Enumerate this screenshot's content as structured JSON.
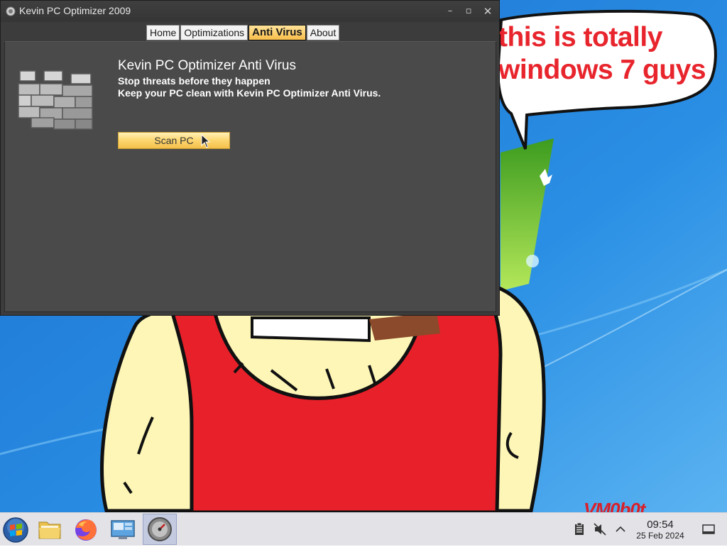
{
  "window": {
    "title": "Kevin PC Optimizer 2009",
    "controls": {
      "minimize": "–",
      "maximize": "▫",
      "close": "✕"
    }
  },
  "tabs": [
    {
      "label": "Home",
      "active": false
    },
    {
      "label": "Optimizations",
      "active": false
    },
    {
      "label": "Anti Virus",
      "active": true
    },
    {
      "label": "About",
      "active": false
    }
  ],
  "antivirus": {
    "heading": "Kevin PC Optimizer Anti Virus",
    "subtitle_1": "Stop threats before they happen",
    "subtitle_2": "Keep your PC clean with Kevin PC Optimizer Anti Virus.",
    "scan_button": "Scan PC",
    "icon": "firewall-brick-wall-icon"
  },
  "desktop": {
    "speech_bubble": [
      "this is totally",
      "windows 7 guys"
    ],
    "watermark": "VM0b0t"
  },
  "taskbar": {
    "items": [
      "start-orb-icon",
      "file-manager-icon",
      "firefox-icon",
      "computer-explorer-icon",
      "optimizer-app-icon"
    ],
    "tray": [
      "clipboard-icon",
      "speaker-muted-icon",
      "chevron-up-icon"
    ],
    "time": "09:54",
    "date": "25 Feb 2024"
  },
  "colors": {
    "accent_tab": "#f8be4a",
    "window_bg": "#3c3c3c",
    "panel_bg": "#4a4a4a",
    "bubble_text": "#e8252d",
    "taskbar_bg": "#e2e2e7"
  }
}
